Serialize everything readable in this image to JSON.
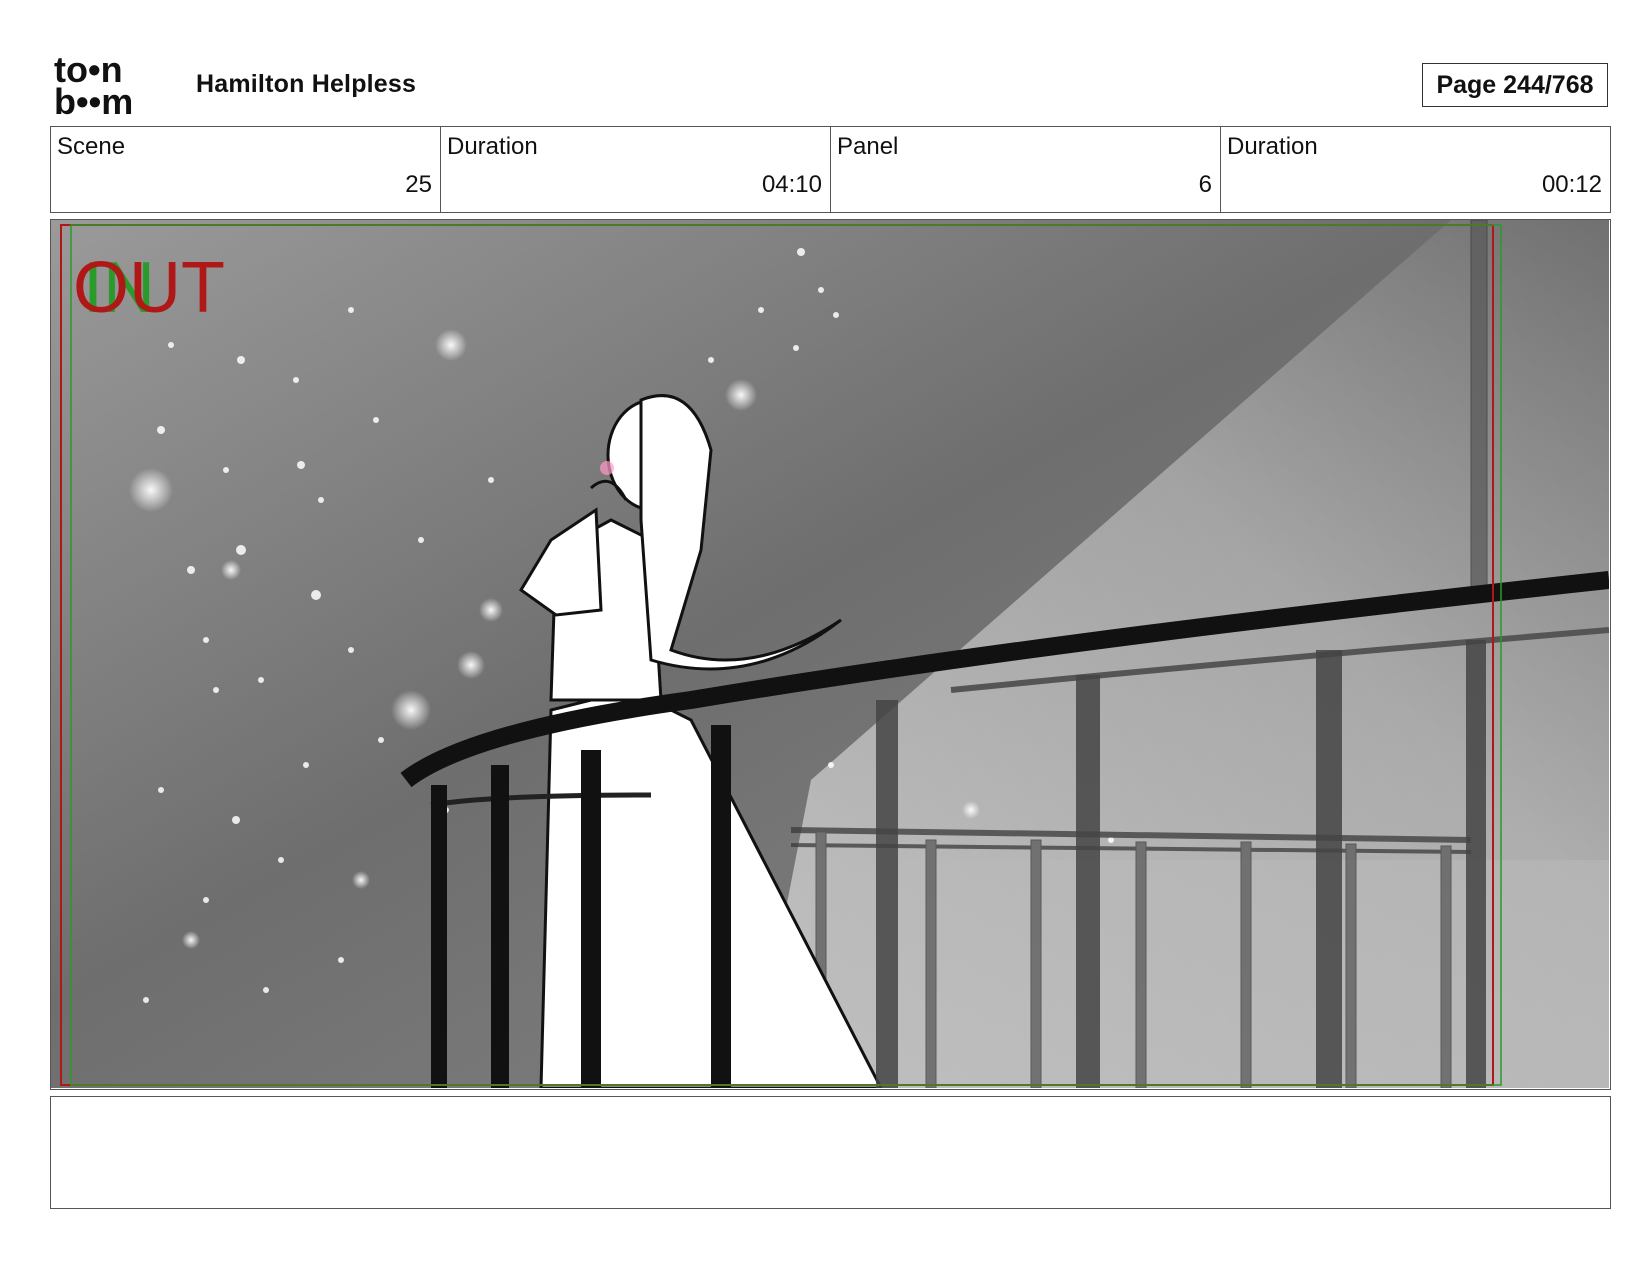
{
  "header": {
    "logo_top": "to•n",
    "logo_bottom": "b••m",
    "project_title": "Hamilton Helpless",
    "page_label": "Page 244/768"
  },
  "info": {
    "scene_label": "Scene",
    "scene_value": "25",
    "scene_duration_label": "Duration",
    "scene_duration_value": "04:10",
    "panel_label": "Panel",
    "panel_value": "6",
    "panel_duration_label": "Duration",
    "panel_duration_value": "00:12"
  },
  "panel": {
    "in_marker": "IN",
    "out_marker": "OUT",
    "in_color": "#2a9a2a",
    "out_color": "#b01818",
    "safe_frame_color": "#b01818",
    "action_frame_color": "#2a9a2a"
  },
  "notes": {
    "text": ""
  }
}
